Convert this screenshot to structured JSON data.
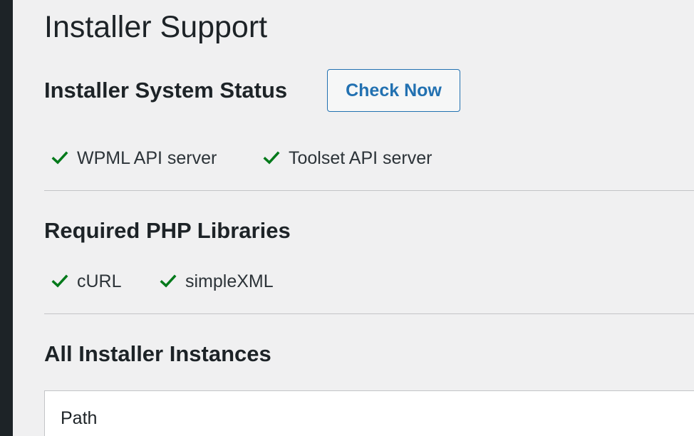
{
  "page": {
    "title": "Installer Support"
  },
  "system_status": {
    "heading": "Installer System Status",
    "check_button_label": "Check Now",
    "items": [
      {
        "label": "WPML API server",
        "icon": "checkmark-icon",
        "status": "ok"
      },
      {
        "label": "Toolset API server",
        "icon": "checkmark-icon",
        "status": "ok"
      }
    ]
  },
  "php_libraries": {
    "heading": "Required PHP Libraries",
    "items": [
      {
        "label": "cURL",
        "icon": "checkmark-icon",
        "status": "ok"
      },
      {
        "label": "simpleXML",
        "icon": "checkmark-icon",
        "status": "ok"
      }
    ]
  },
  "instances": {
    "heading": "All Installer Instances",
    "table": {
      "columns": [
        "Path"
      ]
    }
  },
  "colors": {
    "background": "#f0f0f1",
    "admin_sidebar": "#1d2327",
    "text": "#1d2327",
    "accent": "#2271b1",
    "success": "#00791a",
    "divider": "#c3c4c7"
  }
}
